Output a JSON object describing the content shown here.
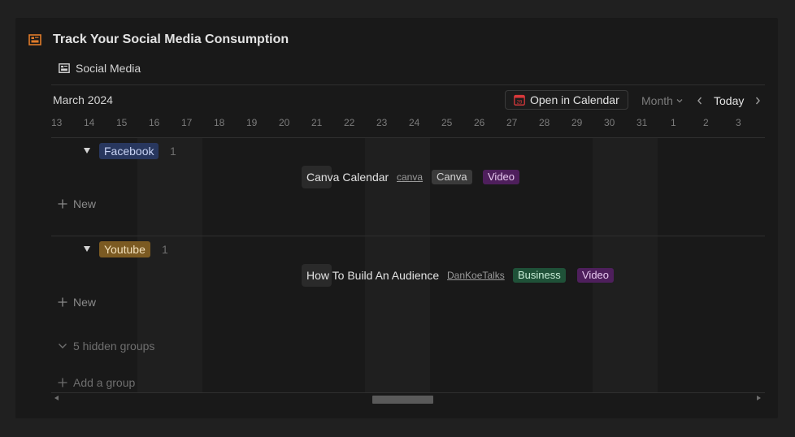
{
  "page": {
    "title": "Track Your Social Media Consumption",
    "view_label": "Social Media"
  },
  "toolbar": {
    "month_label": "March 2024",
    "open_calendar_label": "Open in Calendar",
    "calendar_icon_day": "29",
    "range_label": "Month",
    "today_label": "Today"
  },
  "days": [
    "13",
    "14",
    "15",
    "16",
    "17",
    "18",
    "19",
    "20",
    "21",
    "22",
    "23",
    "24",
    "25",
    "26",
    "27",
    "28",
    "29",
    "30",
    "31",
    "1",
    "2",
    "3"
  ],
  "groups": [
    {
      "name": "Facebook",
      "count": "1",
      "event": {
        "title": "Canva Calendar",
        "link": "canva",
        "tags": [
          "Canva",
          "Video"
        ]
      },
      "new_label": "New"
    },
    {
      "name": "Youtube",
      "count": "1",
      "event": {
        "title": "How To Build An Audience",
        "link": "DanKoeTalks",
        "tags": [
          "Business",
          "Video"
        ]
      },
      "new_label": "New"
    }
  ],
  "hidden_groups_label": "5 hidden groups",
  "add_group_label": "Add a group",
  "colors": {
    "accent_orange": "#e07b2a",
    "facebook_tag": "#28375e",
    "youtube_tag": "#7b5a22",
    "purple_tag": "#4e1f5c",
    "green_tag": "#1f5138",
    "gray_tag": "#3a3a3a"
  }
}
